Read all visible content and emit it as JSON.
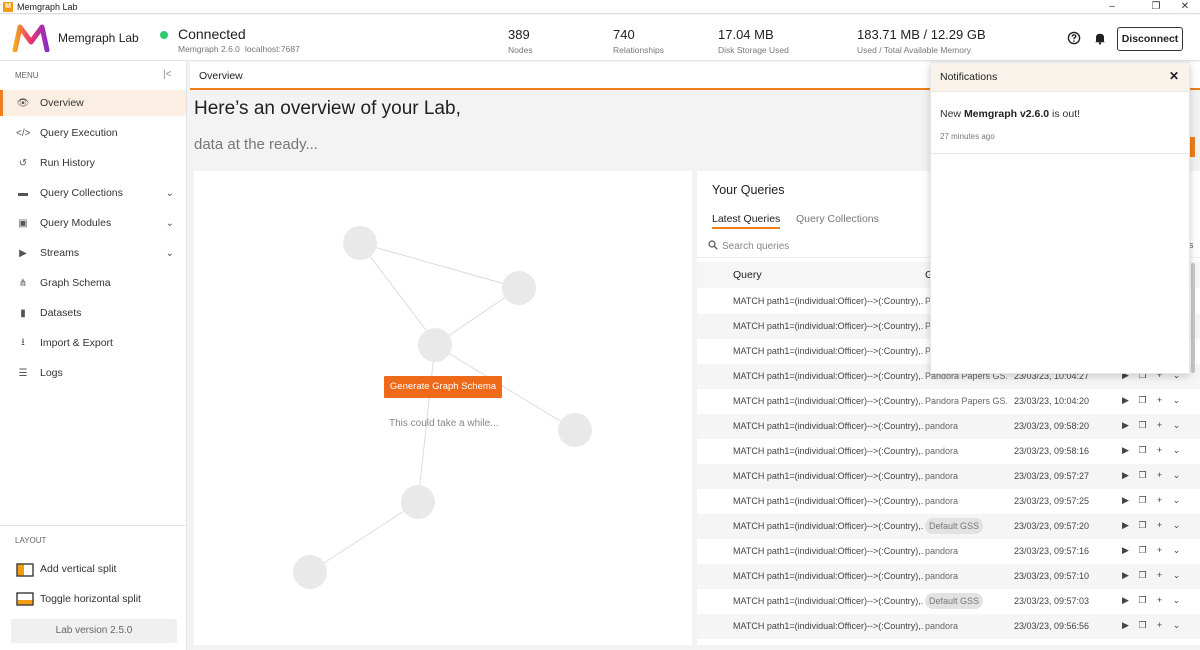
{
  "window": {
    "title": "Memgraph Lab",
    "minimize": "–",
    "maximize": "❐",
    "close": "✕"
  },
  "header": {
    "brand": "Memgraph Lab",
    "connection": {
      "status": "Connected",
      "version": "Memgraph 2.6.0",
      "host": "localhost:7687",
      "status_color": "#2ecc71"
    },
    "stats": [
      {
        "value": "389",
        "label": "Nodes"
      },
      {
        "value": "740",
        "label": "Relationships"
      },
      {
        "value": "17.04 MB",
        "label": "Disk Storage Used"
      },
      {
        "value": "183.71 MB / 12.29 GB",
        "label": "Used / Total Available Memory"
      }
    ],
    "disconnect_label": "Disconnect"
  },
  "sidebar": {
    "menu_label": "MENU",
    "items": [
      {
        "label": "Overview",
        "icon": "eye-icon",
        "glyph": "👁"
      },
      {
        "label": "Query Execution",
        "icon": "code-icon",
        "glyph": "</>"
      },
      {
        "label": "Run History",
        "icon": "history-icon",
        "glyph": "↺"
      },
      {
        "label": "Query Collections",
        "icon": "folder-icon",
        "glyph": "▬"
      },
      {
        "label": "Query Modules",
        "icon": "module-icon",
        "glyph": "▣"
      },
      {
        "label": "Streams",
        "icon": "play-icon",
        "glyph": "▶"
      },
      {
        "label": "Graph Schema",
        "icon": "schema-icon",
        "glyph": "⋔"
      },
      {
        "label": "Datasets",
        "icon": "dataset-icon",
        "glyph": "▮"
      },
      {
        "label": "Import & Export",
        "icon": "download-icon",
        "glyph": "⭳"
      },
      {
        "label": "Logs",
        "icon": "list-icon",
        "glyph": "☰"
      }
    ],
    "layout_label": "LAYOUT",
    "layout_items": [
      {
        "label": "Add vertical split"
      },
      {
        "label": "Toggle horizontal split"
      }
    ],
    "version": "Lab version 2.5.0"
  },
  "main": {
    "tab": "Overview",
    "heading": "Here’s an overview of your Lab,",
    "subheading": "data at the ready...",
    "generate_button": "Generate Graph Schema",
    "wait_text": "This could take a while..."
  },
  "queries": {
    "title": "Your Queries",
    "tabs": [
      "Latest Queries",
      "Query Collections"
    ],
    "search_placeholder": "Search queries",
    "columns": [
      "Query",
      "G"
    ],
    "rows": [
      {
        "query": "MATCH path1=(individual:Officer)-->(:Country),...",
        "graph": "P",
        "badge": false,
        "date": ""
      },
      {
        "query": "MATCH path1=(individual:Officer)-->(:Country),...",
        "graph": "P",
        "badge": false,
        "date": ""
      },
      {
        "query": "MATCH path1=(individual:Officer)-->(:Country),...",
        "graph": "P",
        "badge": false,
        "date": ""
      },
      {
        "query": "MATCH path1=(individual:Officer)-->(:Country),...",
        "graph": "Pandora Papers GS...",
        "badge": false,
        "date": "23/03/23, 10:04:27"
      },
      {
        "query": "MATCH path1=(individual:Officer)-->(:Country),...",
        "graph": "Pandora Papers GS...",
        "badge": false,
        "date": "23/03/23, 10:04:20"
      },
      {
        "query": "MATCH path1=(individual:Officer)-->(:Country),...",
        "graph": "pandora",
        "badge": false,
        "date": "23/03/23, 09:58:20"
      },
      {
        "query": "MATCH path1=(individual:Officer)-->(:Country),...",
        "graph": "pandora",
        "badge": false,
        "date": "23/03/23, 09:58:16"
      },
      {
        "query": "MATCH path1=(individual:Officer)-->(:Country),...",
        "graph": "pandora",
        "badge": false,
        "date": "23/03/23, 09:57:27"
      },
      {
        "query": "MATCH path1=(individual:Officer)-->(:Country),...",
        "graph": "pandora",
        "badge": false,
        "date": "23/03/23, 09:57:25"
      },
      {
        "query": "MATCH path1=(individual:Officer)-->(:Country),...",
        "graph": "Default GSS",
        "badge": true,
        "date": "23/03/23, 09:57:20"
      },
      {
        "query": "MATCH path1=(individual:Officer)-->(:Country),...",
        "graph": "pandora",
        "badge": false,
        "date": "23/03/23, 09:57:16"
      },
      {
        "query": "MATCH path1=(individual:Officer)-->(:Country),...",
        "graph": "pandora",
        "badge": false,
        "date": "23/03/23, 09:57:10"
      },
      {
        "query": "MATCH path1=(individual:Officer)-->(:Country),...",
        "graph": "Default GSS",
        "badge": true,
        "date": "23/03/23, 09:57:03"
      },
      {
        "query": "MATCH path1=(individual:Officer)-->(:Country),...",
        "graph": "pandora",
        "badge": false,
        "date": "23/03/23, 09:56:56"
      }
    ],
    "side_letter": "s"
  },
  "notifications": {
    "title": "Notifications",
    "close": "✕",
    "message_prefix": "New ",
    "message_bold": "Memgraph v2.6.0",
    "message_suffix": " is out!",
    "time": "27 minutes ago"
  },
  "colors": {
    "accent": "#ee7f1a",
    "button": "#ee6a18",
    "connected": "#2ecc71"
  }
}
